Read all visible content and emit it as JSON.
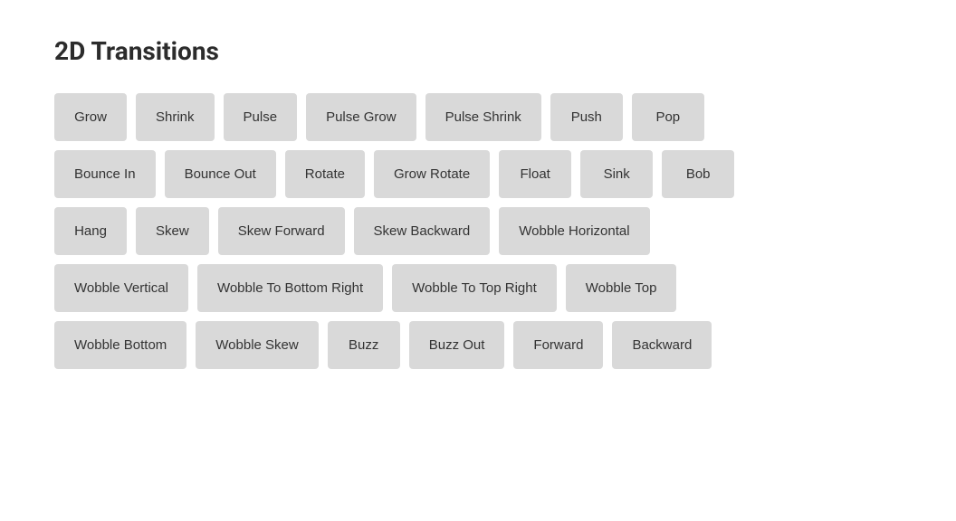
{
  "title": "2D Transitions",
  "rows": [
    {
      "id": "row1",
      "buttons": [
        "Grow",
        "Shrink",
        "Pulse",
        "Pulse Grow",
        "Pulse Shrink",
        "Push",
        "Pop"
      ]
    },
    {
      "id": "row2",
      "buttons": [
        "Bounce In",
        "Bounce Out",
        "Rotate",
        "Grow Rotate",
        "Float",
        "Sink",
        "Bob"
      ]
    },
    {
      "id": "row3",
      "buttons": [
        "Hang",
        "Skew",
        "Skew Forward",
        "Skew Backward",
        "Wobble Horizontal"
      ]
    },
    {
      "id": "row4",
      "buttons": [
        "Wobble Vertical",
        "Wobble To Bottom Right",
        "Wobble To Top Right",
        "Wobble Top"
      ]
    },
    {
      "id": "row5",
      "buttons": [
        "Wobble Bottom",
        "Wobble Skew",
        "Buzz",
        "Buzz Out",
        "Forward",
        "Backward"
      ]
    }
  ]
}
